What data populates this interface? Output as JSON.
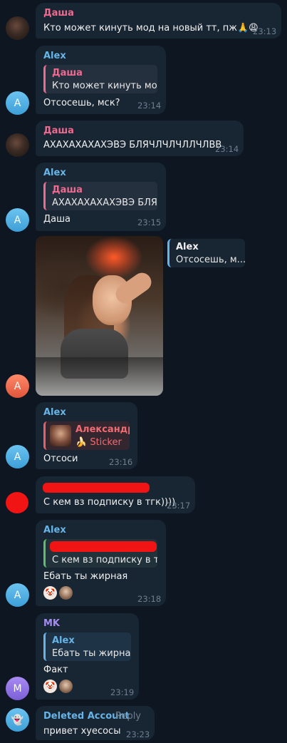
{
  "messages": {
    "m1": {
      "sender": "Даша",
      "text": "Кто может кинуть мод на новый тт, пж🙏😩",
      "time": "23:13"
    },
    "m2": {
      "sender": "Alex",
      "reply_name": "Даша",
      "reply_text": "Кто может кинуть мо...",
      "text": "Отсосешь, мск?",
      "time": "23:14",
      "avatar": "A"
    },
    "m3": {
      "sender": "Даша",
      "text": "АХАХАХАХАХЭВЭ БЛЯЧЛЧЛЧЛЛЧЛВВ",
      "time": "23:14"
    },
    "m4": {
      "sender": "Alex",
      "reply_name": "Даша",
      "reply_text": "АХАХАХАХАХЭВЭ БЛЯ...",
      "text": "Даша",
      "time": "23:15",
      "avatar": "A"
    },
    "m5": {
      "fwd_name": "Alex",
      "fwd_text": "Отсосешь, м...",
      "avatar": "A"
    },
    "m6": {
      "sender": "Alex",
      "reply_name": "Александр",
      "reply_text": "🍌 Sticker",
      "text": "Отсоси",
      "time": "23:16",
      "avatar": "A"
    },
    "m7": {
      "text": "С кем вз подписку в тгк))))",
      "time": "23:17"
    },
    "m8": {
      "sender": "Alex",
      "reply_text": "С кем вз подписку в т...",
      "text": "Ебать ты жирная",
      "time": "23:18",
      "avatar": "A",
      "reaction1": "🤡"
    },
    "m9": {
      "sender": "MK",
      "reply_name": "Alex",
      "reply_text": "Ебать ты жирная",
      "text": "Факт",
      "time": "23:19",
      "avatar": "M",
      "reaction1": "🤡"
    },
    "m10": {
      "sender": "Deleted Account",
      "reply_label": "Reply",
      "text": "привет хуесосы",
      "time": "23:23",
      "avatar_icon": "👻"
    }
  },
  "colors": {
    "background": "#0e1621",
    "bubble": "#182533",
    "name_pink": "#ee6a8f",
    "name_blue": "#67b5e8",
    "name_purple": "#a58cf0",
    "time": "#6d7f8f",
    "redaction": "#f01414"
  }
}
